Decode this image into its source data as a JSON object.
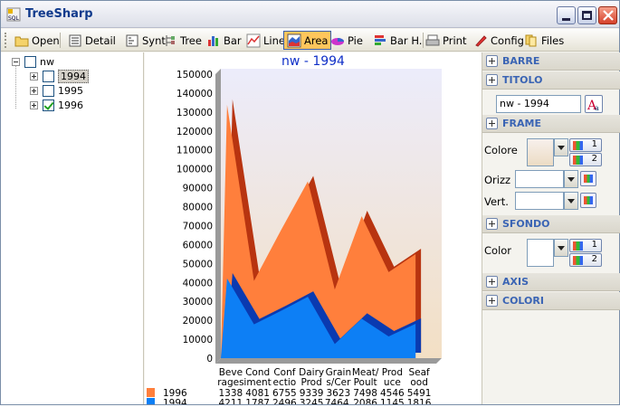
{
  "window": {
    "title": "TreeSharp"
  },
  "toolbar": [
    {
      "label": "Open",
      "icon": "folder-open-icon"
    },
    {
      "label": "Detail",
      "icon": "detail-list-icon"
    },
    {
      "label": "Synt",
      "icon": "synthesis-icon"
    },
    {
      "label": "Tree",
      "icon": "tree-icon"
    },
    {
      "label": "Bar",
      "icon": "bar-chart-icon"
    },
    {
      "label": "Line",
      "icon": "line-chart-icon"
    },
    {
      "label": "Area",
      "icon": "area-chart-icon",
      "active": true
    },
    {
      "label": "Pie",
      "icon": "pie-chart-icon"
    },
    {
      "label": "Bar H.",
      "icon": "horizontal-bar-icon"
    },
    {
      "label": "Print",
      "icon": "printer-icon"
    },
    {
      "label": "Config",
      "icon": "pencil-icon"
    },
    {
      "label": "Files",
      "icon": "files-icon"
    }
  ],
  "tree": {
    "root": "nw",
    "children": [
      {
        "label": "1994",
        "checked": false,
        "selected": true
      },
      {
        "label": "1995",
        "checked": false
      },
      {
        "label": "1996",
        "checked": true
      }
    ]
  },
  "chart_data": {
    "type": "area",
    "title": "nw - 1994",
    "categories": [
      "Beve rages",
      "Cond iment",
      "Conf ectio",
      "Dairy Prod",
      "Grain s/Cer",
      "Meat/ Poult",
      "Prod uce",
      "Seaf ood"
    ],
    "category_lines": [
      [
        "Beve",
        "rages"
      ],
      [
        "Cond",
        "iment"
      ],
      [
        "Conf",
        "ectio"
      ],
      [
        "Dairy",
        "Prod"
      ],
      [
        "Grain",
        "s/Cer"
      ],
      [
        "Meat/",
        "Poult"
      ],
      [
        "Prod",
        "uce"
      ],
      [
        "Seaf",
        "ood"
      ]
    ],
    "series": [
      {
        "name": "1996",
        "color": "#ff7f3c",
        "values": [
          133800,
          40810,
          67550,
          93390,
          36230,
          74980,
          45460,
          54910
        ],
        "labels": [
          "1338",
          "4081",
          "6755",
          "9339",
          "3623",
          "7498",
          "4546",
          "5491"
        ]
      },
      {
        "name": "1994",
        "color": "#0d7ff5",
        "values": [
          42110,
          17870,
          24960,
          32450,
          7464,
          20860,
          11450,
          18160
        ],
        "labels": [
          "4211",
          "1787",
          "2496",
          "3245",
          "7464,",
          "2086",
          "1145",
          "1816"
        ]
      }
    ],
    "stacked": false,
    "ylim": [
      0,
      150000
    ],
    "yticks": [
      0,
      10000,
      20000,
      30000,
      40000,
      50000,
      60000,
      70000,
      80000,
      90000,
      100000,
      110000,
      120000,
      130000,
      140000,
      150000
    ],
    "background_gradient": [
      "#ececfb",
      "#f3dfc4"
    ]
  },
  "panel": {
    "sections": [
      "BARRE",
      "TITOLO",
      "FRAME",
      "SFONDO",
      "AXIS",
      "COLORI"
    ],
    "title_value": "nw - 1994",
    "frame": {
      "colore_label": "Colore",
      "orizz_label": "Orizz",
      "vert_label": "Vert."
    },
    "sfondo": {
      "color_label": "Color"
    },
    "palette_buttons": [
      "1",
      "2"
    ]
  }
}
